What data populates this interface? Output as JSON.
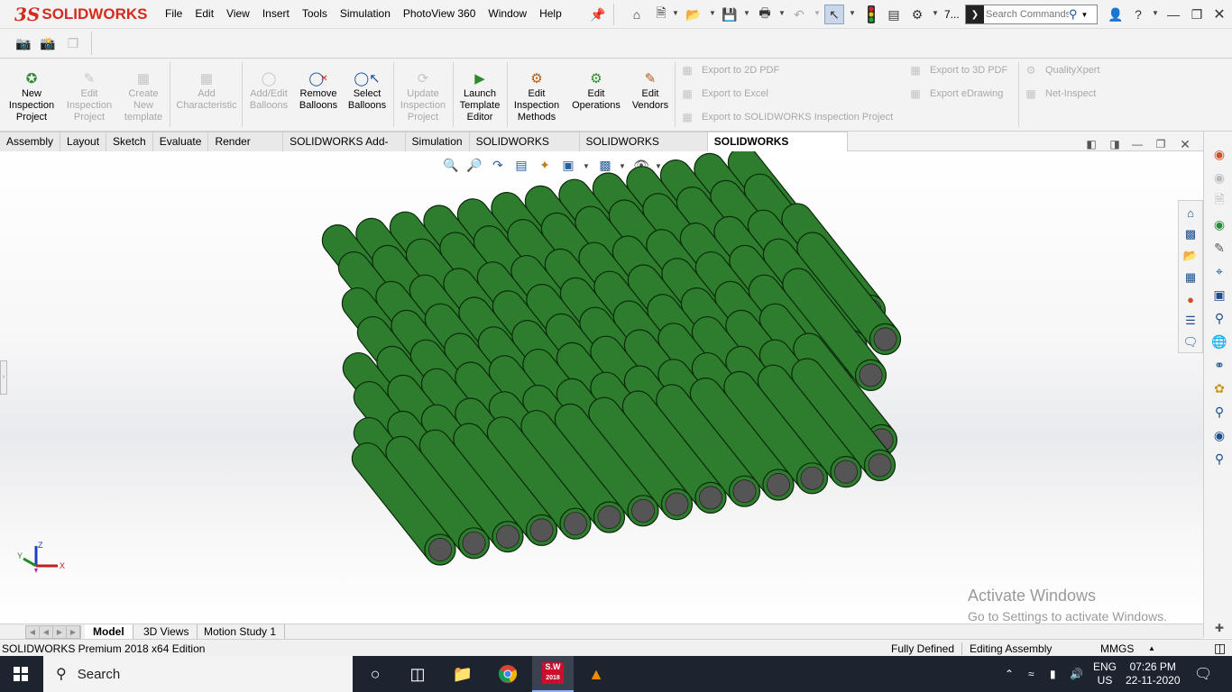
{
  "titlebar": {
    "logo_ds": "3S",
    "logo_text": "SOLIDWORKS",
    "menu": [
      "File",
      "Edit",
      "View",
      "Insert",
      "Tools",
      "Simulation",
      "PhotoView 360",
      "Window",
      "Help"
    ],
    "overflow_label": "7...",
    "search_placeholder": "Search Commands"
  },
  "ribbon": {
    "buttons": [
      {
        "label": "New Inspection Project",
        "lines": [
          "New",
          "Inspection",
          "Project"
        ],
        "enabled": true,
        "icon": "new-inspection-project-icon"
      },
      {
        "label": "Edit Inspection Project",
        "lines": [
          "Edit",
          "Inspection",
          "Project"
        ],
        "enabled": false,
        "icon": "edit-inspection-project-icon"
      },
      {
        "label": "Create New template",
        "lines": [
          "Create",
          "New",
          "template"
        ],
        "enabled": false,
        "icon": "create-template-icon"
      },
      {
        "label": "Add Characteristic",
        "lines": [
          "Add",
          "Characteristic"
        ],
        "enabled": false,
        "icon": "add-characteristic-icon"
      },
      {
        "label": "Add/Edit Balloons",
        "lines": [
          "Add/Edit",
          "Balloons"
        ],
        "enabled": false,
        "icon": "add-edit-balloons-icon"
      },
      {
        "label": "Remove Balloons",
        "lines": [
          "Remove",
          "Balloons"
        ],
        "enabled": true,
        "icon": "remove-balloons-icon"
      },
      {
        "label": "Select Balloons",
        "lines": [
          "Select",
          "Balloons"
        ],
        "enabled": true,
        "icon": "select-balloons-icon"
      },
      {
        "label": "Update Inspection Project",
        "lines": [
          "Update",
          "Inspection",
          "Project"
        ],
        "enabled": false,
        "icon": "update-inspection-project-icon"
      },
      {
        "label": "Launch Template Editor",
        "lines": [
          "Launch",
          "Template",
          "Editor"
        ],
        "enabled": true,
        "icon": "launch-template-editor-icon"
      },
      {
        "label": "Edit Inspection Methods",
        "lines": [
          "Edit",
          "Inspection",
          "Methods"
        ],
        "enabled": true,
        "icon": "edit-inspection-methods-icon"
      },
      {
        "label": "Edit Operations",
        "lines": [
          "Edit",
          "Operations"
        ],
        "enabled": true,
        "icon": "edit-operations-icon"
      },
      {
        "label": "Edit Vendors",
        "lines": [
          "Edit",
          "Vendors"
        ],
        "enabled": true,
        "icon": "edit-vendors-icon"
      }
    ],
    "exports": {
      "pdf2d": "Export to 2D PDF",
      "excel": "Export to Excel",
      "sw_inspection": "Export to SOLIDWORKS Inspection Project",
      "pdf3d": "Export to 3D PDF",
      "edrawing": "Export eDrawing",
      "qualityxpert": "QualityXpert",
      "netinspect": "Net-Inspect"
    }
  },
  "tabs": [
    "Assembly",
    "Layout",
    "Sketch",
    "Evaluate",
    "Render Tools",
    "SOLIDWORKS Add-Ins",
    "Simulation",
    "SOLIDWORKS MBD",
    "SOLIDWORKS Visualize",
    "SOLIDWORKS Inspection"
  ],
  "active_tab": "SOLIDWORKS Inspection",
  "model": {
    "cylinder_color": "#2e7d2e",
    "cylinder_edge": "#0a2a0a",
    "cap_color": "#555555"
  },
  "triad": {
    "x": "X",
    "y": "Y",
    "z": "Z"
  },
  "watermark": {
    "line1": "Activate Windows",
    "line2": "Go to Settings to activate Windows."
  },
  "bottom_tabs": [
    "Model",
    "3D Views",
    "Motion Study 1"
  ],
  "status": {
    "edition": "SOLIDWORKS Premium 2018 x64 Edition",
    "state": "Fully Defined",
    "mode": "Editing Assembly",
    "units": "MMGS"
  },
  "taskbar": {
    "search_label": "Search",
    "sw_badge": "2018",
    "lang": "ENG",
    "region": "US",
    "time": "07:26 PM",
    "date": "22-11-2020"
  }
}
